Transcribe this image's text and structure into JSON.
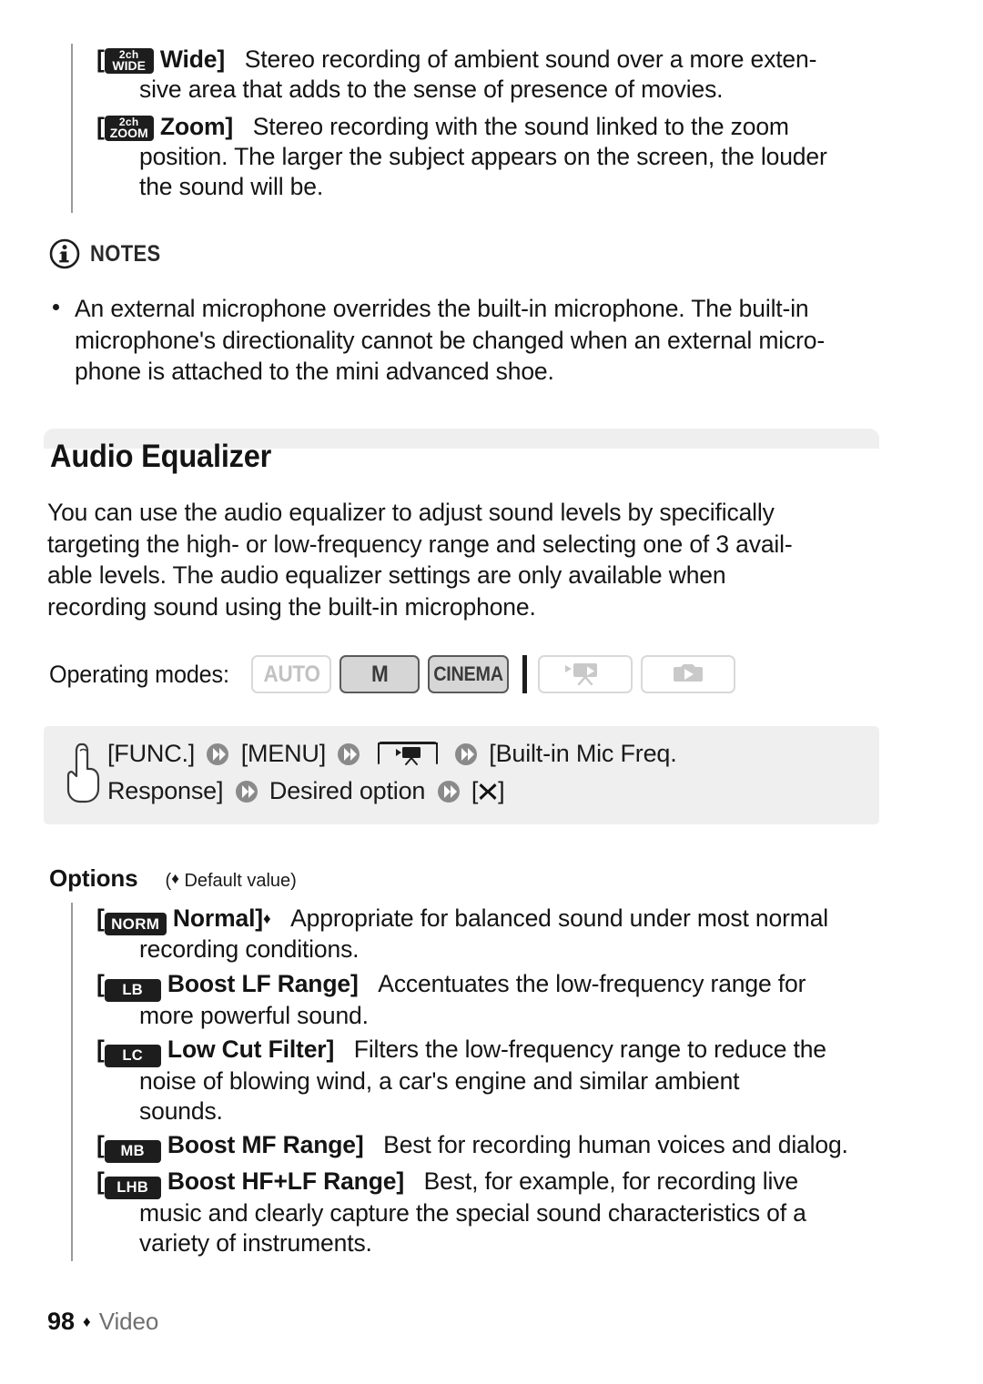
{
  "top_options": [
    {
      "badge": {
        "line1": "2ch",
        "line2": "WIDE",
        "name": "2ch-wide-badge"
      },
      "term": "Wide]",
      "open_bracket": "[",
      "description": "Stereo recording of ambient sound over a more exten-",
      "continuation": "sive area that adds to the sense of presence of movies."
    },
    {
      "badge": {
        "line1": "2ch",
        "line2": "ZOOM",
        "name": "2ch-zoom-badge"
      },
      "term": "Zoom]",
      "open_bracket": "[",
      "description": "Stereo recording with the sound linked to the zoom",
      "continuation": "position. The larger the subject appears on the screen, the louder",
      "continuation2": "the sound will be."
    }
  ],
  "notes": {
    "label": "NOTES",
    "icon": "info-circle-icon",
    "bullets": [
      "An external microphone overrides the built-in microphone. The built-in microphone's directionality cannot be changed when an external micro-phone is attached to the mini advanced shoe."
    ],
    "bullet_lines": [
      "An external microphone overrides the built-in microphone. The built-in",
      "microphone's directionality cannot be changed when an external micro-",
      "phone is attached to the mini advanced shoe."
    ]
  },
  "section": {
    "title": "Audio Equalizer",
    "intro_lines": [
      "You can use the audio equalizer to adjust sound levels by specifically",
      "targeting the high- or low-frequency range and selecting one of 3 avail-",
      "able levels. The audio equalizer settings are only available when",
      "recording sound using the built-in microphone."
    ]
  },
  "operating_modes": {
    "label": "Operating modes:",
    "buttons": [
      {
        "label": "AUTO",
        "state": "off",
        "type": "text",
        "name": "mode-auto"
      },
      {
        "label": "M",
        "state": "on",
        "type": "text",
        "name": "mode-manual"
      },
      {
        "label": "CINEMA",
        "state": "on",
        "type": "text",
        "name": "mode-cinema"
      },
      {
        "label": "",
        "state": "off",
        "type": "movie-playback-icon",
        "name": "mode-movie-playback"
      },
      {
        "label": "",
        "state": "off",
        "type": "photo-playback-icon",
        "name": "mode-photo-playback"
      }
    ]
  },
  "nav_path": {
    "hand_icon": "pointing-hand-icon",
    "steps": [
      {
        "type": "text",
        "label": "[FUNC.]"
      },
      {
        "type": "chevron",
        "label": "chevron-right-icon"
      },
      {
        "type": "text",
        "label": "[MENU]"
      },
      {
        "type": "chevron",
        "label": "chevron-right-icon"
      },
      {
        "type": "icon",
        "label": "movie-camera-icon"
      },
      {
        "type": "chevron",
        "label": "chevron-right-icon"
      },
      {
        "type": "text",
        "label": "[Built-in Mic Freq."
      },
      {
        "type": "text",
        "label": "Response]"
      },
      {
        "type": "chevron",
        "label": "chevron-right-icon"
      },
      {
        "type": "text",
        "label": "Desired option"
      },
      {
        "type": "chevron",
        "label": "chevron-right-icon"
      },
      {
        "type": "text",
        "label": "[✖]"
      }
    ],
    "line1_a": "[FUNC.]",
    "line1_b": "[MENU]",
    "line1_c": "[Built-in Mic Freq.",
    "line2_a": "Response]",
    "line2_b": "Desired option",
    "line2_open": "[",
    "line2_close": "]"
  },
  "options_header": {
    "label": "Options",
    "default_note": "Default value)",
    "default_prefix": "(",
    "diamond": "♦"
  },
  "options": [
    {
      "badge": "NORM",
      "badge_name": "norm-badge",
      "term": "Normal]",
      "is_default": true,
      "lines": [
        "Appropriate for balanced sound under most normal",
        "recording conditions."
      ]
    },
    {
      "badge": "LB",
      "badge_name": "lb-badge",
      "term": "Boost LF Range]",
      "is_default": false,
      "lines": [
        "Accentuates the low-frequency range for",
        "more powerful sound."
      ]
    },
    {
      "badge": "LC",
      "badge_name": "lc-badge",
      "term": "Low Cut Filter]",
      "is_default": false,
      "lines": [
        "Filters the low-frequency range to reduce the",
        "noise of blowing wind, a car's engine and similar ambient",
        "sounds."
      ]
    },
    {
      "badge": "MB",
      "badge_name": "mb-badge",
      "term": "Boost MF Range]",
      "is_default": false,
      "lines": [
        "Best for recording human voices and dialog."
      ]
    },
    {
      "badge": "LHB",
      "badge_name": "lhb-badge",
      "term": "Boost HF+LF Range]",
      "is_default": false,
      "lines": [
        "Best, for example, for recording live",
        "music and clearly capture the special sound characteristics of a",
        "variety of instruments."
      ]
    }
  ],
  "footer": {
    "page_number": "98",
    "diamond": "♦",
    "label": "Video"
  },
  "colors": {
    "band": "#efefef",
    "rule": "#9a9a9a",
    "badge_bg": "#1d1d1d",
    "mode_on_bg": "#d6d6d6",
    "mode_on_border": "#5a5a5a",
    "mode_off_border": "#d9d9d9",
    "mode_off_text": "#c2c2c2",
    "footer_label": "#6f6f6f"
  }
}
